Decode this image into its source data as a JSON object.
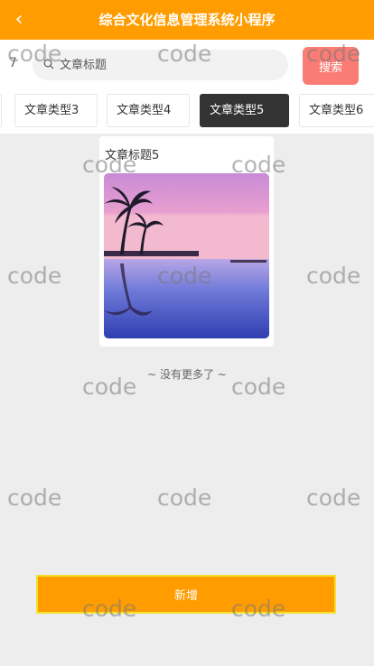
{
  "header": {
    "back_icon": "chevron-left-icon",
    "title": "综合文化信息管理系统小程序"
  },
  "search": {
    "prefix": "7",
    "placeholder": "文章标题",
    "button_label": "搜索"
  },
  "tabs": [
    {
      "label": "文章类型3",
      "active": false
    },
    {
      "label": "文章类型4",
      "active": false
    },
    {
      "label": "文章类型5",
      "active": true
    },
    {
      "label": "文章类型6",
      "active": false
    }
  ],
  "articles": [
    {
      "title": "文章标题5"
    }
  ],
  "list_end_text": "~ 没有更多了 ~",
  "add_button_label": "新增",
  "watermark_text": "code",
  "colors": {
    "brand": "#ff9d00",
    "search_button": "#fa7c74",
    "active_tab": "#333333",
    "background": "#ededed"
  }
}
